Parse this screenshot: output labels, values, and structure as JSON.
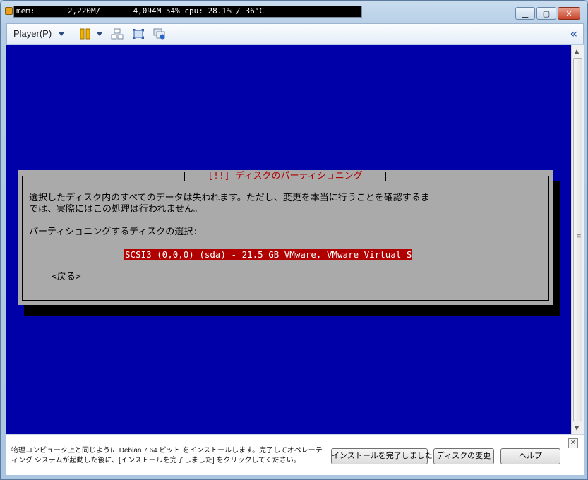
{
  "titlebar": {
    "status_text": "mem:       2,220M/       4,094M 54% cpu: 28.1% / 36'C",
    "minimize_icon": "minimize-icon",
    "maximize_icon": "maximize-icon",
    "close_icon": "close-icon"
  },
  "toolbar": {
    "player_menu": "Player(P)",
    "icons": [
      "pause-icon",
      "send-ctrl-alt-del-icon",
      "fullscreen-icon",
      "unity-icon",
      "collapse-icon"
    ]
  },
  "dialog": {
    "title": "[!!] ディスクのパーティショニング",
    "message_line1": "選択したディスク内のすべてのデータは失われます。ただし、変更を本当に行うことを確認するま",
    "message_line2": "では、実際にはこの処理は行われません。",
    "prompt": "パーティショニングするディスクの選択:",
    "selected_disk": "SCSI3 (0,0,0) (sda) - 21.5 GB VMware, VMware Virtual S",
    "back_button": "<戻る>"
  },
  "infobar": {
    "message": "物理コンピュータ上と同じように Debian 7 64 ビット をインストールします。完了してオペレーティング システムが起動した後に、[インストールを完了しました] をクリックしてください。",
    "install_done_button": "インストールを完了しました",
    "change_disk_button": "ディスクの変更",
    "help_button": "ヘルプ",
    "close_glyph": "✕"
  },
  "colors": {
    "vm_background": "#0000a8",
    "dialog_background": "#aaaaaa",
    "dialog_title": "#b00000",
    "selection": "#b00000"
  }
}
